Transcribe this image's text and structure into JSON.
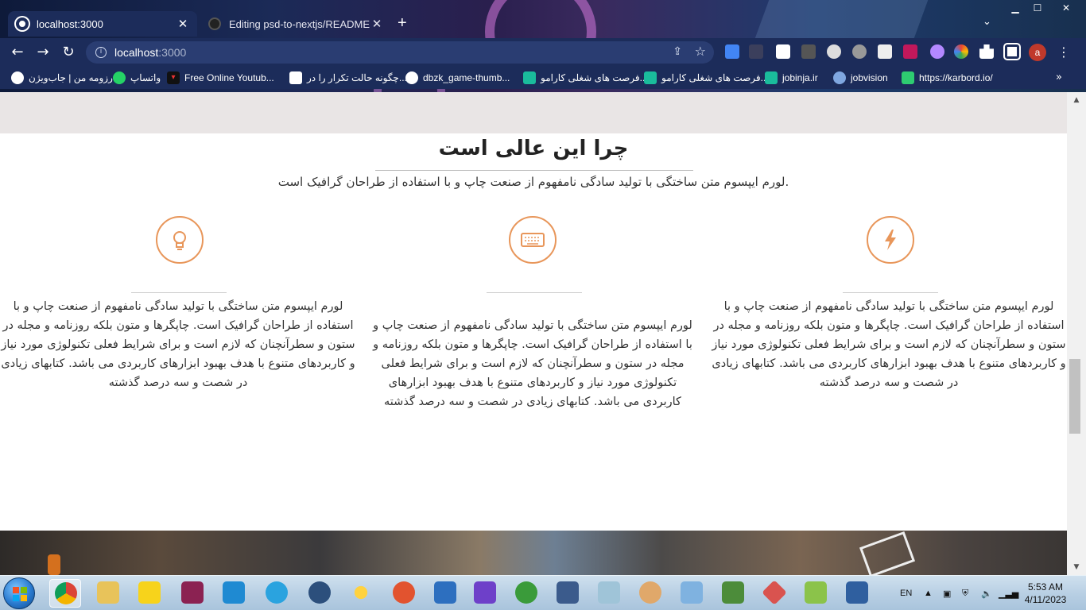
{
  "browser": {
    "tabs": [
      {
        "title": "localhost:3000",
        "active": true
      },
      {
        "title": "Editing psd-to-nextjs/README.m",
        "active": false
      }
    ],
    "window_controls": {
      "min": "▁",
      "max": "☐",
      "close": "✕"
    },
    "address": {
      "host": "localhost",
      "port": ":3000"
    },
    "profile_initial": "a",
    "bookmarks": [
      "رزومه من | جاب‌ویژن",
      "واتساپ",
      "Free Online Youtub...",
      "چگونه حالت تکرار را در...",
      "dbzk_game-thumb...",
      "فرصت های شغلی کارامو...",
      "فرصت های شغلی کارامو...",
      "jobinja.ir",
      "jobvision",
      "https://karbord.io/"
    ]
  },
  "page": {
    "heading": "چرا این عالی است",
    "subtitle": "لورم ایپسوم متن ساختگی با تولید سادگی نامفهوم از صنعت چاپ و با استفاده از طراحان گرافیک است.",
    "features": [
      {
        "icon": "lightning-icon",
        "text": "لورم ایپسوم متن ساختگی با تولید سادگی نامفهوم از صنعت چاپ و با استفاده از طراحان گرافیک است. چاپگرها و متون بلکه روزنامه و مجله در ستون و سطرآنچنان که لازم است و برای شرایط فعلی تکنولوژی مورد نیاز و کاربردهای متنوع با هدف بهبود ابزارهای کاربردی می باشد. کتابهای زیادی در شصت و سه درصد گذشته"
      },
      {
        "icon": "keyboard-icon",
        "text": "لورم ایپسوم متن ساختگی با تولید سادگی نامفهوم از صنعت چاپ و با استفاده از طراحان گرافیک است. چاپگرها و متون بلکه روزنامه و مجله در ستون و سطرآنچنان که لازم است و برای شرایط فعلی تکنولوژی مورد نیاز و کاربردهای متنوع با هدف بهبود ابزارهای کاربردی می باشد. کتابهای زیادی در شصت و سه درصد گذشته"
      },
      {
        "icon": "lightbulb-icon",
        "text": "لورم ایپسوم متن ساختگی با تولید سادگی نامفهوم از صنعت چاپ و با استفاده از طراحان گرافیک است. چاپگرها و متون بلکه روزنامه و مجله در ستون و سطرآنچنان که لازم است و برای شرایط فعلی تکنولوژی مورد نیاز و کاربردهای متنوع با هدف بهبود ابزارهای کاربردی می باشد. کتابهای زیادی در شصت و سه درصد گذشته"
      }
    ],
    "accent_color": "#e8965a"
  },
  "taskbar": {
    "language": "EN",
    "time": "5:53 AM",
    "date": "4/11/2023"
  }
}
